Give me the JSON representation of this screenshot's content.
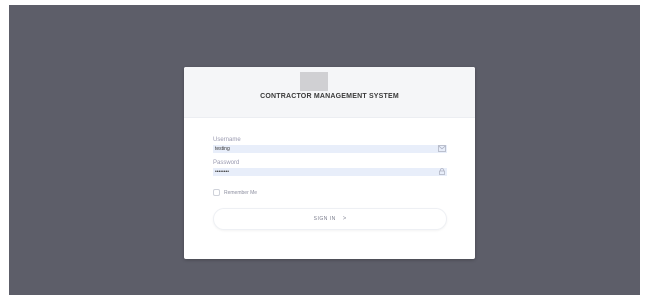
{
  "app": {
    "title": "CONTRACTOR MANAGEMENT SYSTEM"
  },
  "login": {
    "username_label": "Username",
    "username_value": "testing",
    "password_label": "Password",
    "password_value": "••••••••",
    "remember_label": "Remember Me",
    "signin_label": "SIGN IN",
    "signin_icon": ">"
  },
  "icons": {
    "username": "envelope-icon",
    "password": "lock-icon"
  },
  "colors": {
    "backdrop": "#5d5e69",
    "input_fill": "#e8eefa"
  }
}
